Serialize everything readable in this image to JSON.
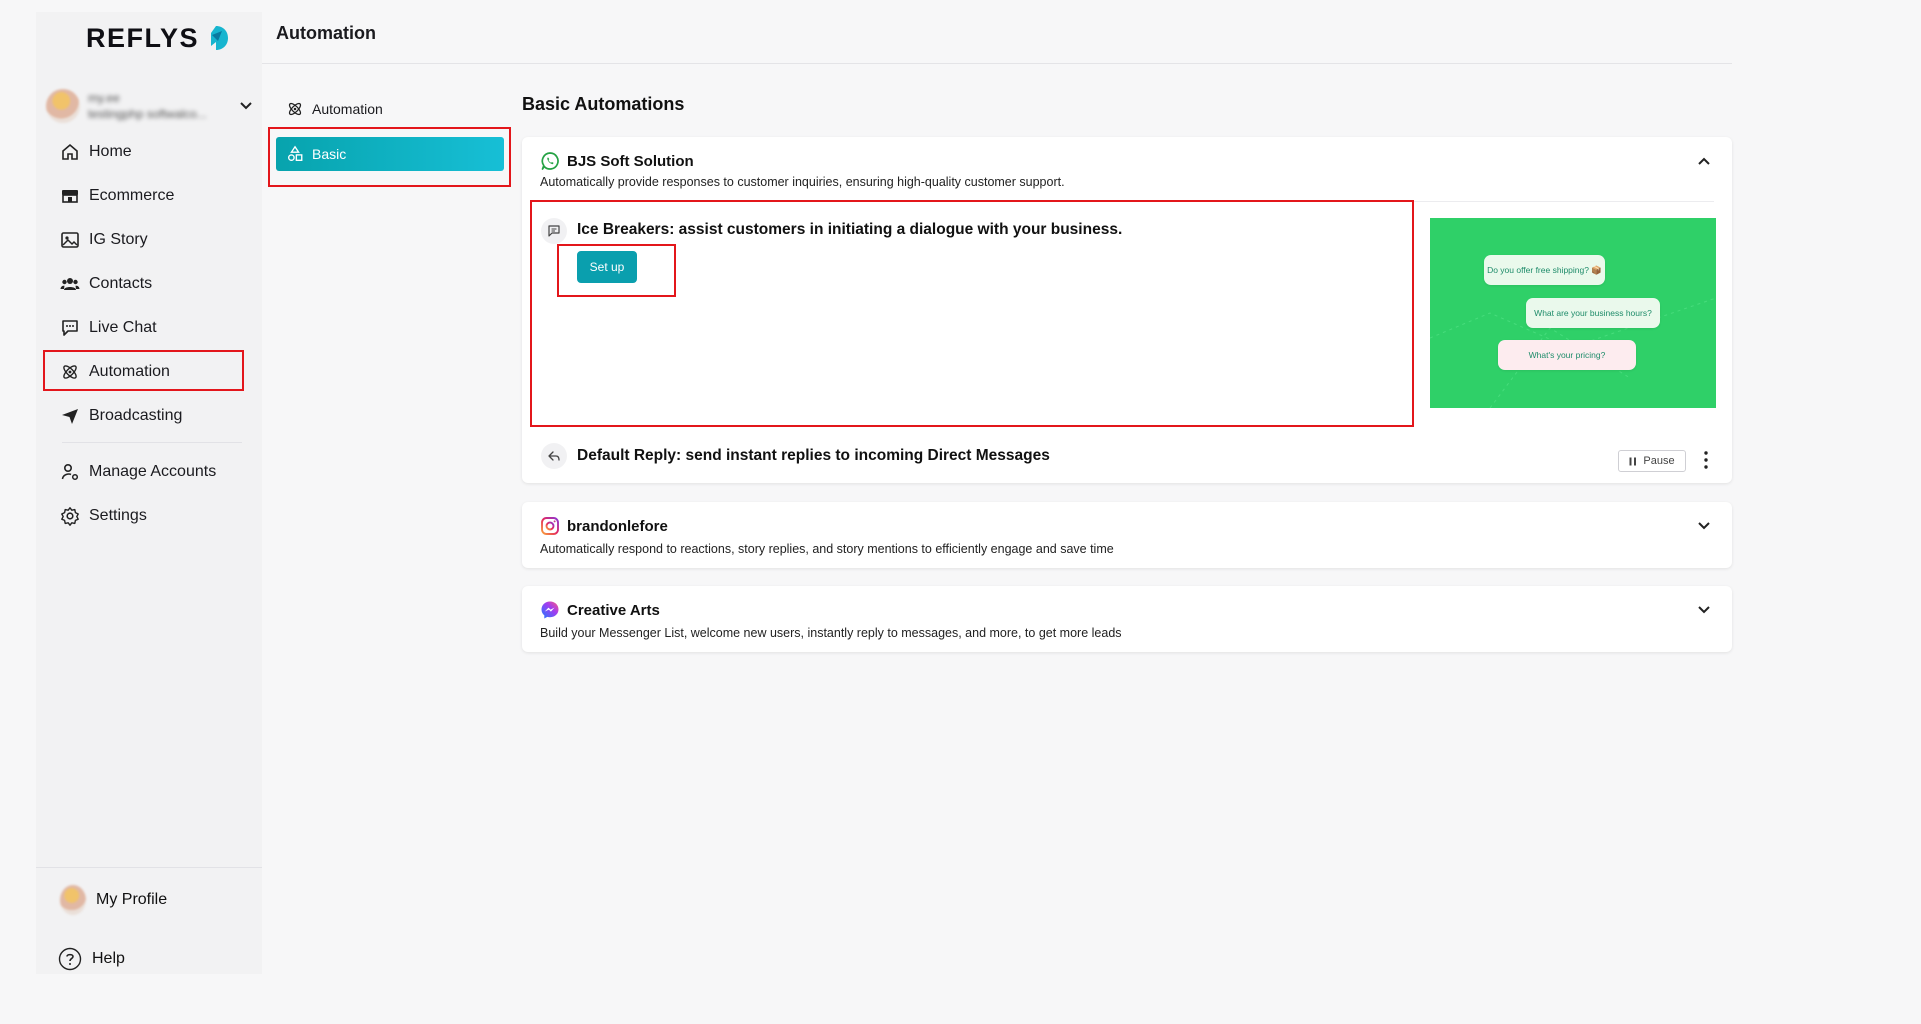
{
  "brand": {
    "name": "REFLYS"
  },
  "account": {
    "name": "my.ee",
    "email": "testingphp softwalco..."
  },
  "sidebar": {
    "items": [
      {
        "label": "Home",
        "icon": "home-icon"
      },
      {
        "label": "Ecommerce",
        "icon": "store-icon"
      },
      {
        "label": "IG Story",
        "icon": "image-icon"
      },
      {
        "label": "Contacts",
        "icon": "users-icon"
      },
      {
        "label": "Live Chat",
        "icon": "chat-icon"
      },
      {
        "label": "Automation",
        "icon": "automation-icon"
      },
      {
        "label": "Broadcasting",
        "icon": "send-icon"
      },
      {
        "label": "Manage Accounts",
        "icon": "user-cog-icon"
      },
      {
        "label": "Settings",
        "icon": "gear-icon"
      }
    ],
    "profile_label": "My Profile",
    "help_label": "Help"
  },
  "header": {
    "title": "Automation"
  },
  "subnav": {
    "automation": "Automation",
    "basic": "Basic"
  },
  "main": {
    "title": "Basic Automations",
    "cards": [
      {
        "name": "BJS Soft Solution",
        "platform": "whatsapp",
        "description": "Automatically provide responses to customer inquiries, ensuring high-quality customer support.",
        "expanded": true,
        "ice_breakers": {
          "title": "Ice Breakers: assist customers in initiating a dialogue with your business.",
          "button": "Set up",
          "preview_bubbles": [
            "Do you offer free shipping? 📦",
            "What are your business hours?",
            "What's your pricing?"
          ]
        },
        "default_reply": {
          "title": "Default Reply: send instant replies to incoming Direct Messages",
          "button": "Pause"
        }
      },
      {
        "name": "brandonlefore",
        "platform": "instagram",
        "description": "Automatically respond to reactions, story replies, and story mentions to efficiently engage and save time",
        "expanded": false
      },
      {
        "name": "Creative Arts",
        "platform": "messenger",
        "description": "Build your Messenger List, welcome new users, instantly reply to messages, and more, to get more leads",
        "expanded": false
      }
    ]
  },
  "colors": {
    "accent": "#0a9fae",
    "highlight": "#e3161b",
    "preview_bg": "#2fd068"
  }
}
